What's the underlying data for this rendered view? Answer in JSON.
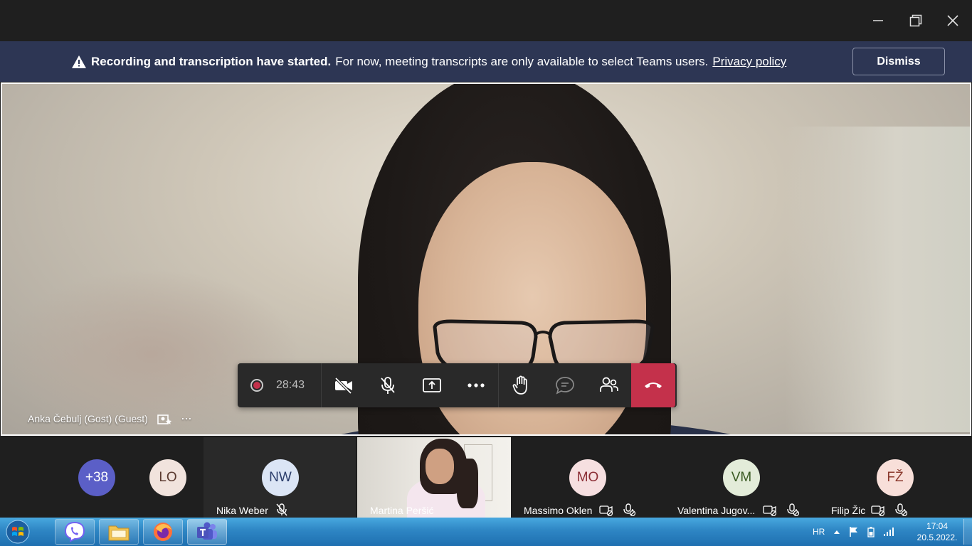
{
  "banner": {
    "bold_text": "Recording and transcription have started.",
    "text": "For now, meeting transcripts are only available to select Teams users.",
    "link": "Privacy policy",
    "dismiss_label": "Dismiss"
  },
  "stage": {
    "speaker_name": "Anka Čebulj (Gost) (Guest)",
    "more_label": "···"
  },
  "toolbar": {
    "timer": "28:43"
  },
  "participants": {
    "overflow_count": "+38",
    "lo_initials": "LO",
    "tiles": [
      {
        "initials": "NW",
        "name": "Nika Weber"
      },
      {
        "initials": "",
        "name": "Martina Peršić"
      },
      {
        "initials": "MO",
        "name": "Massimo Oklen"
      },
      {
        "initials": "VM",
        "name": "Valentina Jugov..."
      },
      {
        "initials": "FŽ",
        "name": "Filip Žic"
      }
    ]
  },
  "taskbar": {
    "language": "HR",
    "time": "17:04",
    "date": "20.5.2022."
  },
  "colors": {
    "banner_bg": "#2d3654",
    "leave_red": "#c4314b",
    "toolbar_bg": "#292929"
  }
}
